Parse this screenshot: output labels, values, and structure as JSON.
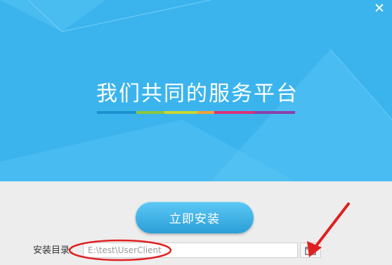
{
  "window": {
    "close_glyph": "✕"
  },
  "hero": {
    "slogan": "我们共同的服务平台",
    "background_color": "#3bb4ee",
    "color_bar": [
      "#1e90d0",
      "#8cc63f",
      "#c9d730",
      "#f0a13b",
      "#d9317a",
      "#8b3fa8"
    ]
  },
  "install": {
    "button_label": "立即安装",
    "dir_label": "安装目录：",
    "dir_value": "E:\\test\\UserClient",
    "browse_icon": "folder-icon"
  },
  "annotations": {
    "highlight_color": "#e02020"
  }
}
